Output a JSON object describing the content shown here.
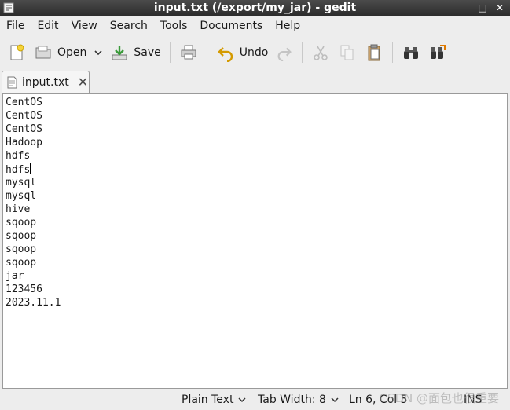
{
  "window": {
    "title": "input.txt (/export/my_jar) - gedit",
    "controls": [
      "_",
      "□",
      "✕"
    ]
  },
  "menu": [
    "File",
    "Edit",
    "View",
    "Search",
    "Tools",
    "Documents",
    "Help"
  ],
  "toolbar": {
    "open_label": "Open",
    "save_label": "Save",
    "undo_label": "Undo"
  },
  "tab": {
    "label": "input.txt"
  },
  "document": {
    "lines": [
      "CentOS",
      "CentOS",
      "CentOS",
      "Hadoop",
      "hdfs",
      "hdfs",
      "mysql",
      "mysql",
      "hive",
      "sqoop",
      "sqoop",
      "sqoop",
      "sqoop",
      "jar",
      "123456",
      "2023.11.1"
    ],
    "cursor_line": 6
  },
  "status": {
    "language": "Plain Text",
    "tab_width": "Tab Width: 8",
    "position": "Ln 6, Col 5",
    "mode": "INS"
  },
  "watermark": "CSDN @面包也很重要"
}
